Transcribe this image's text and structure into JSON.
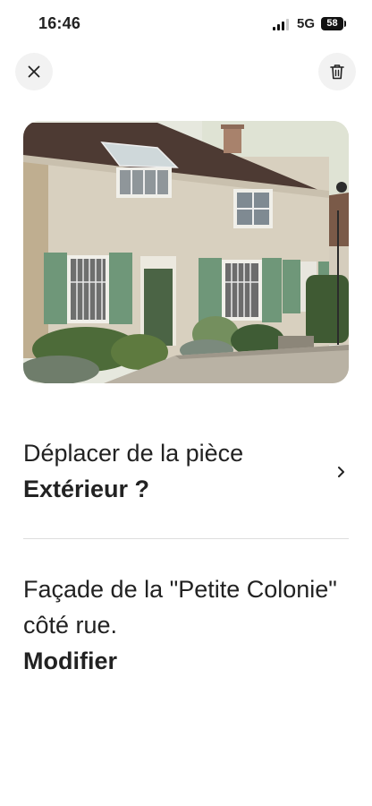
{
  "status_bar": {
    "time": "16:46",
    "network": "5G",
    "battery": "58"
  },
  "header": {
    "close_icon": "close-icon",
    "delete_icon": "trash-icon"
  },
  "photo": {
    "subject": "house-facade-photo"
  },
  "move_row": {
    "prompt": "Déplacer de la pièce",
    "room": "Extérieur ?",
    "icon": "chevron-right-icon"
  },
  "caption": {
    "text": "Façade de la \"Petite Colonie\" côté rue.",
    "edit_label": "Modifier"
  },
  "colors": {
    "background": "#ffffff",
    "text": "#222222",
    "button_bg": "#f2f2f2",
    "divider": "#dddddd"
  }
}
